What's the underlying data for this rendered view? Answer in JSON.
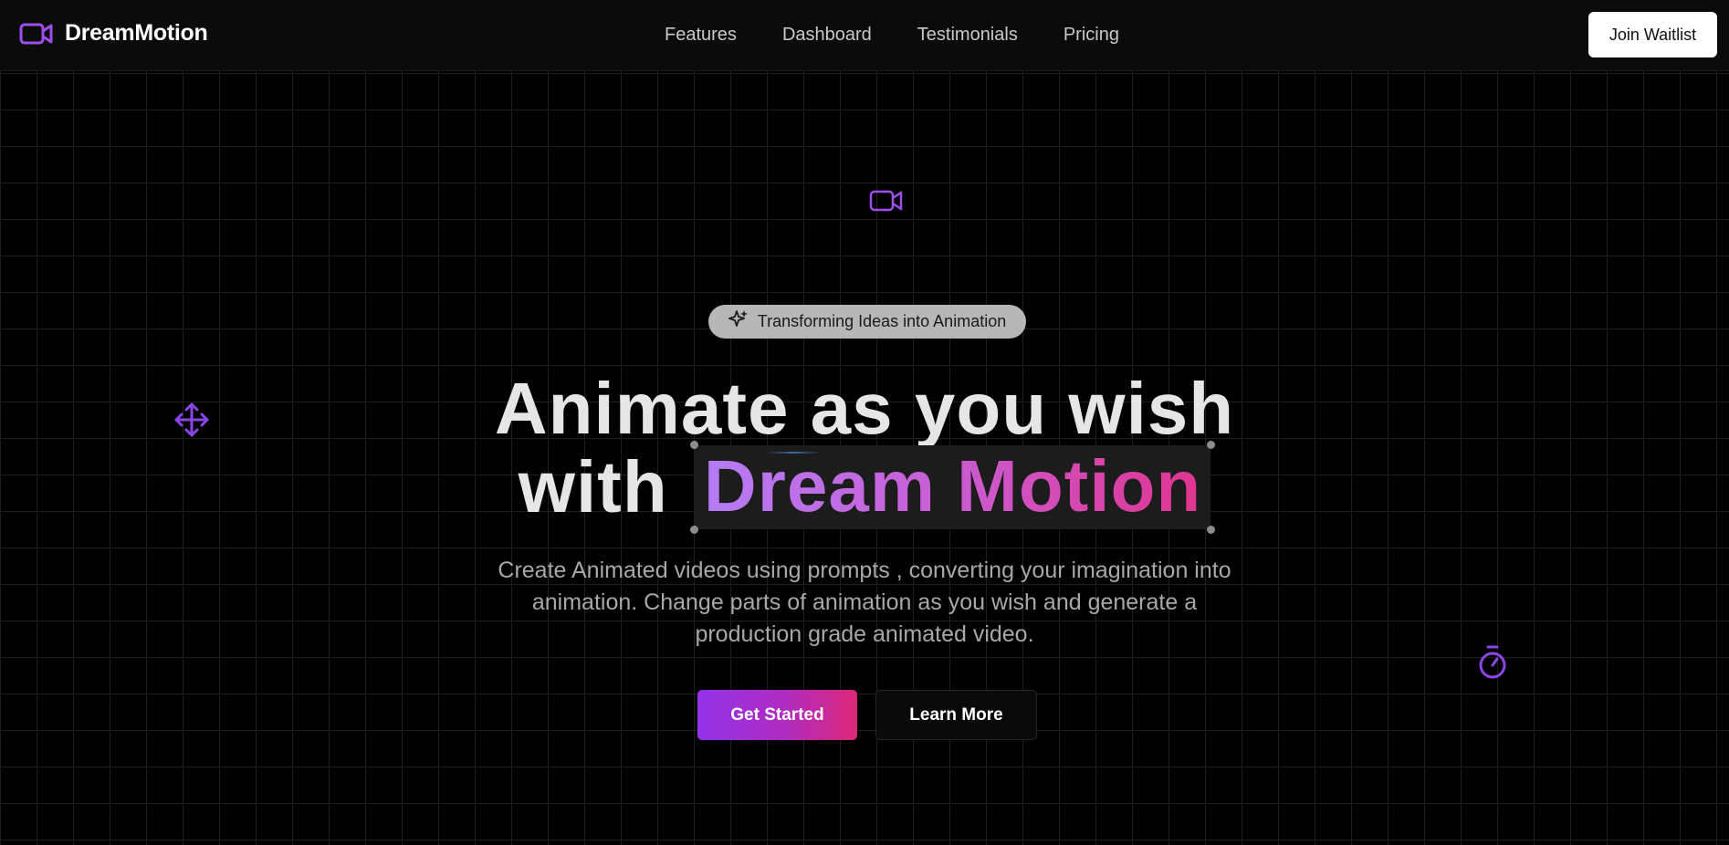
{
  "brand": {
    "name": "DreamMotion",
    "icon": "video-camera-icon"
  },
  "nav": {
    "items": [
      {
        "label": "Features"
      },
      {
        "label": "Dashboard"
      },
      {
        "label": "Testimonials"
      },
      {
        "label": "Pricing"
      }
    ]
  },
  "header": {
    "join_label": "Join Waitlist"
  },
  "hero": {
    "badge_text": "Transforming Ideas into Animation",
    "badge_icon": "sparkles-icon",
    "headline_line1": "Animate as you wish",
    "headline_prefix": "with",
    "headline_highlight": "Dream Motion",
    "description": "Create Animated videos using prompts , converting your imagination into animation. Change parts of animation as you wish and generate a production grade animated video.",
    "primary_cta": "Get Started",
    "secondary_cta": "Learn More"
  },
  "decor_icons": [
    "video-camera-icon",
    "move-arrows-icon",
    "timer-icon"
  ],
  "colors": {
    "accent_purple": "#9333ea",
    "accent_pink": "#db2777",
    "background": "#000000"
  }
}
